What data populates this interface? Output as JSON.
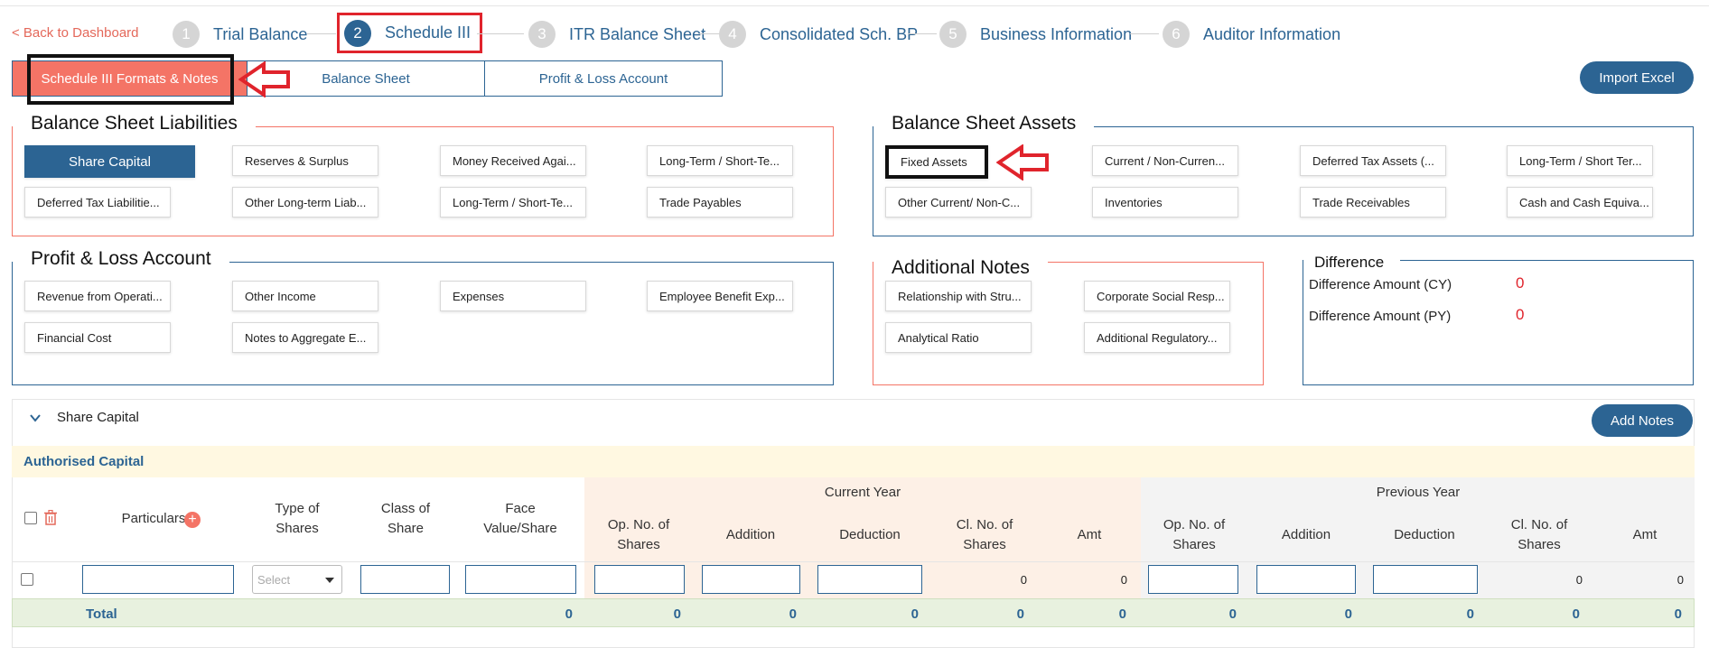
{
  "nav": {
    "back_label": "< Back to Dashboard"
  },
  "steps": [
    {
      "num": "1",
      "label": "Trial Balance"
    },
    {
      "num": "2",
      "label": "Schedule III"
    },
    {
      "num": "3",
      "label": "ITR Balance Sheet"
    },
    {
      "num": "4",
      "label": "Consolidated Sch. BP"
    },
    {
      "num": "5",
      "label": "Business Information"
    },
    {
      "num": "6",
      "label": "Auditor Information"
    }
  ],
  "tabs": [
    {
      "label": "Schedule III Formats & Notes"
    },
    {
      "label": "Balance Sheet"
    },
    {
      "label": "Profit & Loss Account"
    }
  ],
  "import_label": "Import Excel",
  "liabilities": {
    "title": "Balance Sheet Liabilities",
    "items": [
      "Share Capital",
      "Reserves & Surplus",
      "Money Received Agai...",
      "Long-Term / Short-Te...",
      "Deferred Tax Liabilitie...",
      "Other Long-term Liab...",
      "Long-Term / Short-Te...",
      "Trade Payables"
    ]
  },
  "assets": {
    "title": "Balance Sheet Assets",
    "items": [
      "Fixed Assets",
      "Current / Non-Curren...",
      "Deferred Tax Assets (...",
      "Long-Term / Short Ter...",
      "Other Current/ Non-C...",
      "Inventories",
      "Trade Receivables",
      "Cash and Cash Equiva..."
    ]
  },
  "pl": {
    "title": "Profit & Loss Account",
    "items": [
      "Revenue from Operati...",
      "Other Income",
      "Expenses",
      "Employee Benefit Exp...",
      "Financial Cost",
      "Notes to Aggregate E..."
    ]
  },
  "notes": {
    "title": "Additional Notes",
    "items": [
      "Relationship with Stru...",
      "Corporate Social Resp...",
      "Analytical Ratio",
      "Additional Regulatory..."
    ]
  },
  "difference": {
    "title": "Difference",
    "cy_label": "Difference Amount (CY)",
    "cy_value": "0",
    "py_label": "Difference Amount (PY)",
    "py_value": "0"
  },
  "section": {
    "title": "Share Capital",
    "add_notes_label": "Add Notes",
    "subsection": "Authorised Capital"
  },
  "table": {
    "particulars": "Particulars",
    "type_of_shares": [
      "Type of",
      "Shares"
    ],
    "class_of_share": [
      "Class of",
      "Share"
    ],
    "face_value": [
      "Face",
      "Value/Share"
    ],
    "current_year": "Current Year",
    "previous_year": "Previous Year",
    "op_no": [
      "Op. No. of",
      "Shares"
    ],
    "addition": "Addition",
    "deduction": "Deduction",
    "cl_no": [
      "Cl. No. of",
      "Shares"
    ],
    "amt": "Amt",
    "select_placeholder": "Select",
    "row_values": {
      "cy_cl": "0",
      "cy_amt": "0",
      "py_cl": "0",
      "py_amt": "0"
    },
    "total_label": "Total",
    "totals": [
      "0",
      "0",
      "0",
      "0",
      "0",
      "0",
      "0",
      "0",
      "0",
      "0",
      "0"
    ]
  },
  "colors": {
    "primary": "#2c6493",
    "accent": "#f47466",
    "annotation_red": "#e0242c"
  }
}
